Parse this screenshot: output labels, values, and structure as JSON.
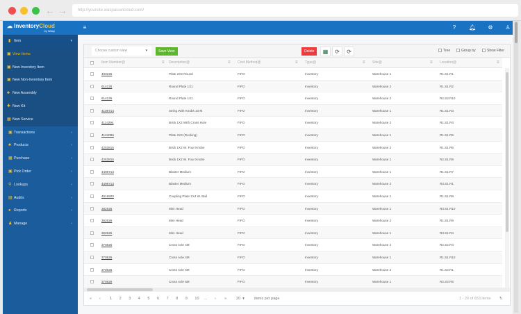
{
  "browser": {
    "url": "http://yoursite.waspassetcloud.com/"
  },
  "app": {
    "logo": "InventoryCloud",
    "logo_sub": "by Wasp",
    "colors": {
      "header": "#1a72c2",
      "sidebar": "#1b5c9c",
      "save": "#5cb82a",
      "delete": "#f03c3c"
    }
  },
  "sidebar": {
    "items": [
      {
        "label": "Item",
        "icon": "item-icon",
        "type": "head"
      },
      {
        "label": "View Items",
        "icon": "view-items-icon",
        "type": "sub",
        "active": true
      },
      {
        "label": "New Inventory Item",
        "icon": "new-item-icon",
        "type": "sub"
      },
      {
        "label": "New Non-Inventory Item",
        "icon": "new-item-icon",
        "type": "sub"
      },
      {
        "label": "New Assembly",
        "icon": "assembly-icon",
        "type": "sub"
      },
      {
        "label": "New Kit",
        "icon": "kit-icon",
        "type": "sub"
      },
      {
        "label": "New Service",
        "icon": "service-icon",
        "type": "sub"
      },
      {
        "label": "Transactions",
        "icon": "transactions-icon",
        "type": "top"
      },
      {
        "label": "Products",
        "icon": "products-icon",
        "type": "top"
      },
      {
        "label": "Purchase",
        "icon": "purchase-icon",
        "type": "top"
      },
      {
        "label": "Pick Order",
        "icon": "pick-order-icon",
        "type": "top"
      },
      {
        "label": "Lookups",
        "icon": "search-icon",
        "type": "top"
      },
      {
        "label": "Audits",
        "icon": "clipboard-icon",
        "type": "top"
      },
      {
        "label": "Reports",
        "icon": "reports-icon",
        "type": "top"
      },
      {
        "label": "Manage",
        "icon": "user-icon",
        "type": "top"
      }
    ]
  },
  "toolbar": {
    "custom_view_placeholder": "Choose custom view",
    "save_view": "Save View",
    "delete": "Delete",
    "tree": "Tree",
    "group_by": "Group by",
    "show_filter": "Show Filter"
  },
  "table": {
    "columns": [
      "Item Number@",
      "Description@",
      "Cost Method@",
      "Type@",
      "Site@",
      "Location@"
    ],
    "rows": [
      [
        "403226",
        "Plate 2X2 Round",
        "FIFO",
        "Inventory",
        "Warehouse 1",
        "R1.S1.R1"
      ],
      [
        "614126",
        "Round Plate 1X1",
        "FIFO",
        "Inventory",
        "Warehouse 2",
        "R1.S1.R2"
      ],
      [
        "614126",
        "Round Plate 1X1",
        "FIFO",
        "Inventory",
        "Warehouse 2",
        "R2.S2.R10"
      ],
      [
        "4109714",
        "String With Knobs 10 M",
        "FIFO",
        "Inventory",
        "Warehouse 1",
        "R1.S1.R3"
      ],
      [
        "4114294",
        "Brick 1X2 With Cross Hole",
        "FIFO",
        "Inventory",
        "Warehouse 2",
        "R1.S1.R4"
      ],
      [
        "4124096",
        "Plate 2X2 (Rocking)",
        "FIFO",
        "Inventory",
        "Warehouse 1",
        "R1.S1.R5"
      ],
      [
        "4253815",
        "Brick 1X2 W. Four Knobs",
        "FIFO",
        "Inventory",
        "Warehouse 2",
        "R1.S1.R6"
      ],
      [
        "4253815",
        "Brick 1X2 W. Four Knobs",
        "FIFO",
        "Inventory",
        "Warehouse 1",
        "R2.S1.R8"
      ],
      [
        "4498713",
        "Blaster Medium",
        "FIFO",
        "Inventory",
        "Warehouse 1",
        "R1.S1.R7"
      ],
      [
        "4498713",
        "Blaster Medium",
        "FIFO",
        "Inventory",
        "Warehouse 2",
        "R3.S1.R1"
      ],
      [
        "4516920",
        "Coupling Plate 1X4 W. Ball",
        "FIFO",
        "Inventory",
        "Warehouse 1",
        "R1.S1.R8"
      ],
      [
        "362626",
        "Mini Head",
        "FIFO",
        "Inventory",
        "Warehouse 1",
        "R3.S1.R10"
      ],
      [
        "362626",
        "Mini Head",
        "FIFO",
        "Inventory",
        "Warehouse 2",
        "R1.S1.R9"
      ],
      [
        "362626",
        "Mini Head",
        "FIFO",
        "Inventory",
        "Warehouse 1",
        "R3.S1.R4"
      ],
      [
        "370526",
        "Cross Axle 4M",
        "FIFO",
        "Inventory",
        "Warehouse 2",
        "R2.S2.R4"
      ],
      [
        "370526",
        "Cross Axle 4M",
        "FIFO",
        "Inventory",
        "Warehouse 1",
        "R1.S1.R10"
      ],
      [
        "370626",
        "Cross Axle 6M",
        "FIFO",
        "Inventory",
        "Warehouse 2",
        "R1.S2.R1"
      ],
      [
        "370626",
        "Cross Axle 6M",
        "FIFO",
        "Inventory",
        "Warehouse 1",
        "R2.S2.R5"
      ]
    ]
  },
  "pager": {
    "pages": [
      "1",
      "2",
      "3",
      "4",
      "5",
      "6",
      "7",
      "8",
      "9",
      "10",
      "..."
    ],
    "current": "1",
    "page_size": "20",
    "items_per_page": "items per page",
    "summary": "1 - 20 of 653 items"
  }
}
